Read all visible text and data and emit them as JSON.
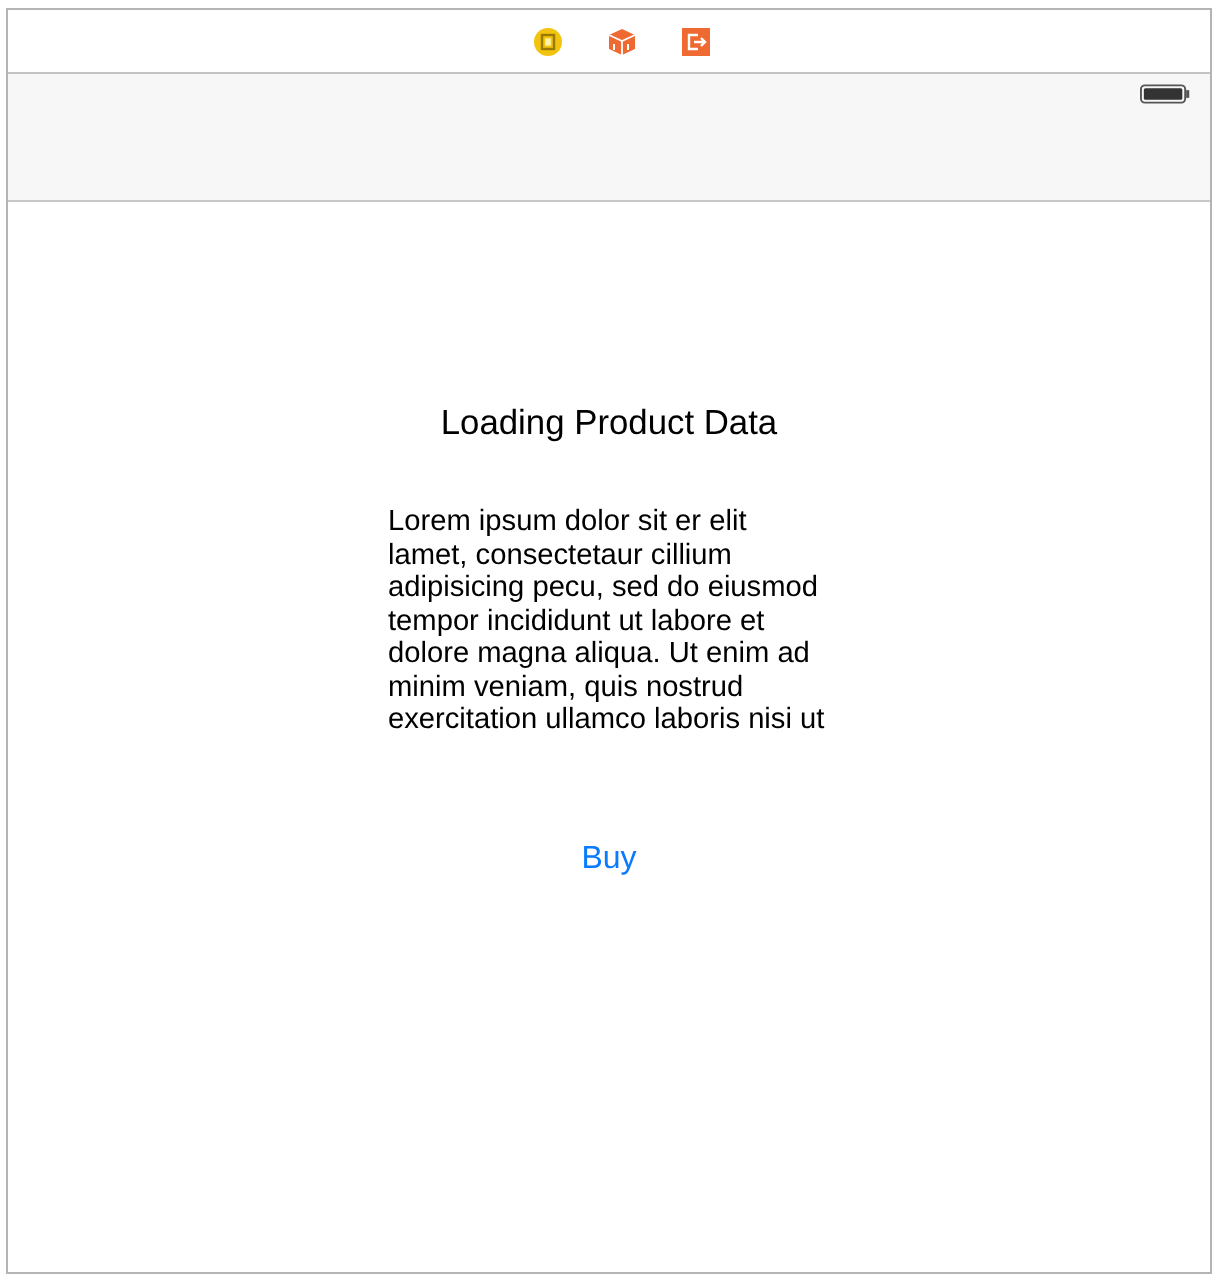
{
  "title": "Loading Product Data",
  "description": "Lorem ipsum dolor sit er elit lamet, consectetaur cillium adipisicing pecu, sed do eiusmod tempor incididunt ut labore et dolore magna aliqua. Ut enim ad minim veniam, quis nostrud exercitation ullamco laboris nisi ut",
  "buttons": [
    {
      "label": "Buy"
    }
  ]
}
